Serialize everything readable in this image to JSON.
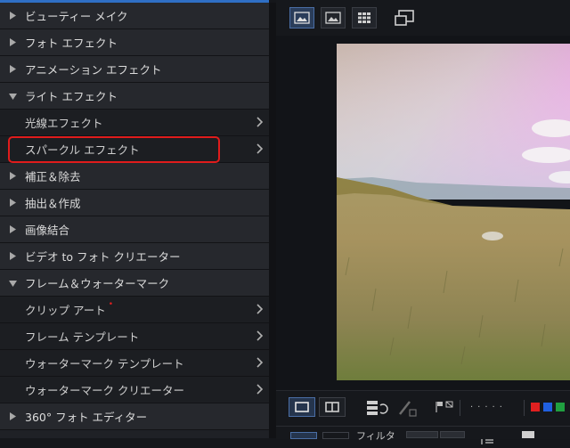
{
  "left_panel": {
    "items": [
      {
        "label": "ビューティー メイク",
        "type": "category",
        "expanded": false
      },
      {
        "label": "フォト エフェクト",
        "type": "category",
        "expanded": false
      },
      {
        "label": "アニメーション エフェクト",
        "type": "category",
        "expanded": false
      },
      {
        "label": "ライト エフェクト",
        "type": "category",
        "expanded": true
      },
      {
        "label": "光線エフェクト",
        "type": "subitem"
      },
      {
        "label": "スパークル エフェクト",
        "type": "subitem",
        "highlighted": true
      },
      {
        "label": "補正＆除去",
        "type": "category",
        "expanded": false
      },
      {
        "label": "抽出＆作成",
        "type": "category",
        "expanded": false
      },
      {
        "label": "画像結合",
        "type": "category",
        "expanded": false
      },
      {
        "label": "ビデオ to フォト クリエーター",
        "type": "category",
        "expanded": false
      },
      {
        "label": "フレーム＆ウォーターマーク",
        "type": "category",
        "expanded": true
      },
      {
        "label": "クリップ アート",
        "type": "subitem",
        "badge": "new"
      },
      {
        "label": "フレーム テンプレート",
        "type": "subitem"
      },
      {
        "label": "ウォーターマーク テンプレート",
        "type": "subitem"
      },
      {
        "label": "ウォーターマーク クリエーター",
        "type": "subitem"
      },
      {
        "label": "360° フォト エディター",
        "type": "category",
        "expanded": false
      }
    ]
  },
  "bottom_toolbar": {
    "filter_label": "フィルタ",
    "color_flags": [
      "#e02020",
      "#2060e0",
      "#20a040"
    ]
  },
  "colors": {
    "accent": "#2f6fc5",
    "highlight": "#e01c1c"
  }
}
